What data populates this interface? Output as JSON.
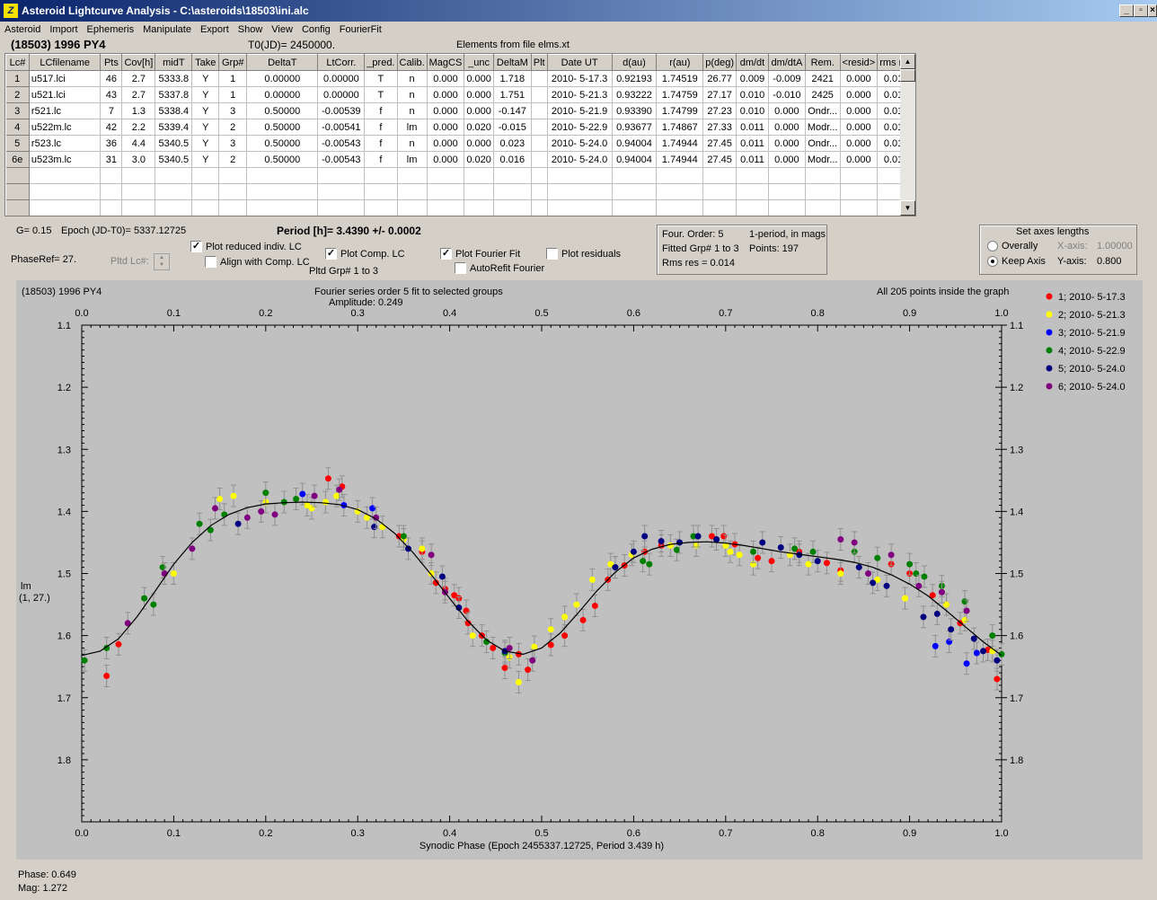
{
  "window": {
    "title": "Asteroid Lightcurve Analysis - C:\\asteroids\\18503\\ini.alc",
    "icon": "app-icon"
  },
  "menu": [
    "Asteroid",
    "Import",
    "Ephemeris",
    "Manipulate",
    "Export",
    "Show",
    "View",
    "Config",
    "FourierFit"
  ],
  "header": {
    "object": "(18503) 1996 PY4",
    "t0": "T0(JD)= 2450000.",
    "elements": "Elements from file elms.xt"
  },
  "table": {
    "columns": [
      "Lc#",
      "LCfilename",
      "Pts",
      "Cov[h]",
      "midT",
      "Take",
      "Grp#",
      "DeltaT",
      "LtCorr.",
      "_pred.",
      "Calib.",
      "MagCS",
      "_unc",
      "DeltaM",
      "Plt",
      "Date UT",
      "d(au)",
      "r(au)",
      "p(deg)",
      "dm/dt",
      "dm/dtA",
      "Rem.",
      "<resid>",
      "rms res"
    ],
    "rows": [
      [
        "1",
        "u517.lci",
        "46",
        "2.7",
        "5333.8",
        "Y",
        "1",
        "0.00000",
        "0.00000",
        "T",
        "n",
        "0.000",
        "0.000",
        "1.718",
        "",
        "2010- 5-17.3",
        "0.92193",
        "1.74519",
        "26.77",
        "0.009",
        "-0.009",
        "2421",
        "0.000",
        "0.015"
      ],
      [
        "2",
        "u521.lci",
        "43",
        "2.7",
        "5337.8",
        "Y",
        "1",
        "0.00000",
        "0.00000",
        "T",
        "n",
        "0.000",
        "0.000",
        "1.751",
        "",
        "2010- 5-21.3",
        "0.93222",
        "1.74759",
        "27.17",
        "0.010",
        "-0.010",
        "2425",
        "0.000",
        "0.013"
      ],
      [
        "3",
        "r521.lc",
        "7",
        "1.3",
        "5338.4",
        "Y",
        "3",
        "0.50000",
        "-0.00539",
        "f",
        "n",
        "0.000",
        "0.000",
        "-0.147",
        "",
        "2010- 5-21.9",
        "0.93390",
        "1.74799",
        "27.23",
        "0.010",
        "0.000",
        "Ondr...",
        "0.000",
        "0.016"
      ],
      [
        "4",
        "u522m.lc",
        "42",
        "2.2",
        "5339.4",
        "Y",
        "2",
        "0.50000",
        "-0.00541",
        "f",
        "lm",
        "0.000",
        "0.020",
        "-0.015",
        "",
        "2010- 5-22.9",
        "0.93677",
        "1.74867",
        "27.33",
        "0.011",
        "0.000",
        "Modr...",
        "0.000",
        "0.013"
      ],
      [
        "5",
        "r523.lc",
        "36",
        "4.4",
        "5340.5",
        "Y",
        "3",
        "0.50000",
        "-0.00543",
        "f",
        "n",
        "0.000",
        "0.000",
        "0.023",
        "",
        "2010- 5-24.0",
        "0.94004",
        "1.74944",
        "27.45",
        "0.011",
        "0.000",
        "Ondr...",
        "0.000",
        "0.013"
      ],
      [
        "6e",
        "u523m.lc",
        "31",
        "3.0",
        "5340.5",
        "Y",
        "2",
        "0.50000",
        "-0.00543",
        "f",
        "lm",
        "0.000",
        "0.020",
        "0.016",
        "",
        "2010- 5-24.0",
        "0.94004",
        "1.74944",
        "27.45",
        "0.011",
        "0.000",
        "Modr...",
        "0.000",
        "0.014"
      ]
    ],
    "empty_rows": 3
  },
  "info": {
    "g": "G= 0.15",
    "epoch": "Epoch (JD-T0)= 5337.12725",
    "period": "Period [h]= 3.4390 +/- 0.0002",
    "phase_ref": "PhaseRef= 27.",
    "pltd_lc": "Pltd Lc#:",
    "plot_reduced": "Plot reduced indiv. LC",
    "align": "Align with Comp. LC",
    "plot_comp": "Plot Comp. LC",
    "pltd_grp": "Pltd Grp#  1   to   3",
    "plot_fourier": "Plot Fourier Fit",
    "autorefit": "AutoRefit Fourier",
    "plot_residuals": "Plot residuals",
    "fourier_box": {
      "order": "Four. Order:  5",
      "mode": "1-period,  in mags",
      "fitted": "Fitted Grp# 1 to 3",
      "points": "Points: 197",
      "rms": "Rms res     = 0.014"
    },
    "axes_box": {
      "title": "Set axes lengths",
      "overally": "Overally",
      "keep_axis": "Keep Axis",
      "x_axis_label": "X-axis:",
      "x_axis_value": "1.00000",
      "y_axis_label": "Y-axis:",
      "y_axis_value": "0.800"
    }
  },
  "plot_header": {
    "object": "(18503) 1996 PY4",
    "fourier_line1": "Fourier series order 5 fit to selected groups",
    "fourier_line2": "Amplitude: 0.249",
    "points_inside": "All 205 points inside the graph",
    "ylabel_line1": "lm",
    "ylabel_line2": "(1, 27.)"
  },
  "status": {
    "phase": "Phase:  0.649",
    "mag": "Mag:    1.272"
  },
  "chart_data": {
    "type": "scatter",
    "title": "",
    "xlabel": "Synodic Phase (Epoch 2455337.12725, Period 3.439 h)",
    "ylabel": "lm",
    "xlim": [
      0.0,
      1.0
    ],
    "ylim": [
      1.1,
      1.9
    ],
    "y_inverted": true,
    "x_ticks": [
      "0.0",
      "0.1",
      "0.2",
      "0.3",
      "0.4",
      "0.5",
      "0.6",
      "0.7",
      "0.8",
      "0.9",
      "1.0"
    ],
    "y_ticks": [
      "1.1",
      "1.2",
      "1.3",
      "1.4",
      "1.5",
      "1.6",
      "1.7",
      "1.8"
    ],
    "legend_position": "right",
    "series": [
      {
        "name": "1; 2010- 5-17.3",
        "color": "#ff0000",
        "points": [
          [
            0.027,
            1.665
          ],
          [
            0.04,
            1.614
          ],
          [
            0.268,
            1.347
          ],
          [
            0.283,
            1.36
          ],
          [
            0.345,
            1.44
          ],
          [
            0.37,
            1.465
          ],
          [
            0.385,
            1.515
          ],
          [
            0.395,
            1.525
          ],
          [
            0.405,
            1.535
          ],
          [
            0.41,
            1.54
          ],
          [
            0.418,
            1.56
          ],
          [
            0.42,
            1.58
          ],
          [
            0.435,
            1.6
          ],
          [
            0.447,
            1.62
          ],
          [
            0.46,
            1.652
          ],
          [
            0.475,
            1.63
          ],
          [
            0.485,
            1.655
          ],
          [
            0.51,
            1.615
          ],
          [
            0.525,
            1.6
          ],
          [
            0.545,
            1.575
          ],
          [
            0.558,
            1.552
          ],
          [
            0.572,
            1.51
          ],
          [
            0.59,
            1.487
          ],
          [
            0.612,
            1.465
          ],
          [
            0.63,
            1.455
          ],
          [
            0.685,
            1.44
          ],
          [
            0.698,
            1.44
          ],
          [
            0.71,
            1.453
          ],
          [
            0.735,
            1.475
          ],
          [
            0.75,
            1.48
          ],
          [
            0.78,
            1.465
          ],
          [
            0.81,
            1.483
          ],
          [
            0.825,
            1.495
          ],
          [
            0.88,
            1.485
          ],
          [
            0.9,
            1.5
          ],
          [
            0.925,
            1.535
          ],
          [
            0.94,
            1.55
          ],
          [
            0.955,
            1.58
          ],
          [
            0.985,
            1.623
          ],
          [
            0.995,
            1.67
          ]
        ]
      },
      {
        "name": "2; 2010- 5-21.3",
        "color": "#ffff00",
        "points": [
          [
            0.1,
            1.5
          ],
          [
            0.15,
            1.38
          ],
          [
            0.165,
            1.375
          ],
          [
            0.2,
            1.385
          ],
          [
            0.245,
            1.39
          ],
          [
            0.25,
            1.395
          ],
          [
            0.265,
            1.385
          ],
          [
            0.277,
            1.375
          ],
          [
            0.3,
            1.4
          ],
          [
            0.31,
            1.41
          ],
          [
            0.327,
            1.425
          ],
          [
            0.35,
            1.445
          ],
          [
            0.37,
            1.46
          ],
          [
            0.38,
            1.5
          ],
          [
            0.425,
            1.6
          ],
          [
            0.465,
            1.635
          ],
          [
            0.475,
            1.675
          ],
          [
            0.492,
            1.618
          ],
          [
            0.51,
            1.59
          ],
          [
            0.525,
            1.57
          ],
          [
            0.538,
            1.55
          ],
          [
            0.555,
            1.51
          ],
          [
            0.575,
            1.485
          ],
          [
            0.598,
            1.47
          ],
          [
            0.64,
            1.455
          ],
          [
            0.668,
            1.455
          ],
          [
            0.7,
            1.455
          ],
          [
            0.705,
            1.465
          ],
          [
            0.715,
            1.47
          ],
          [
            0.73,
            1.485
          ],
          [
            0.77,
            1.47
          ],
          [
            0.79,
            1.485
          ],
          [
            0.825,
            1.5
          ],
          [
            0.865,
            1.51
          ],
          [
            0.895,
            1.54
          ],
          [
            0.94,
            1.55
          ],
          [
            0.96,
            1.575
          ],
          [
            0.99,
            1.625
          ]
        ]
      },
      {
        "name": "3; 2010- 5-21.9",
        "color": "#0000ff",
        "points": [
          [
            0.24,
            1.372
          ],
          [
            0.285,
            1.39
          ],
          [
            0.316,
            1.395
          ],
          [
            0.928,
            1.617
          ],
          [
            0.943,
            1.61
          ],
          [
            0.962,
            1.645
          ],
          [
            0.973,
            1.628
          ]
        ]
      },
      {
        "name": "4; 2010- 5-22.9",
        "color": "#008000",
        "points": [
          [
            0.003,
            1.64
          ],
          [
            0.027,
            1.62
          ],
          [
            0.068,
            1.54
          ],
          [
            0.078,
            1.55
          ],
          [
            0.088,
            1.49
          ],
          [
            0.128,
            1.42
          ],
          [
            0.14,
            1.43
          ],
          [
            0.155,
            1.405
          ],
          [
            0.2,
            1.37
          ],
          [
            0.22,
            1.385
          ],
          [
            0.233,
            1.38
          ],
          [
            0.35,
            1.44
          ],
          [
            0.44,
            1.61
          ],
          [
            0.46,
            1.628
          ],
          [
            0.58,
            1.49
          ],
          [
            0.61,
            1.48
          ],
          [
            0.617,
            1.485
          ],
          [
            0.647,
            1.462
          ],
          [
            0.665,
            1.44
          ],
          [
            0.69,
            1.445
          ],
          [
            0.73,
            1.465
          ],
          [
            0.775,
            1.46
          ],
          [
            0.795,
            1.465
          ],
          [
            0.84,
            1.465
          ],
          [
            0.865,
            1.475
          ],
          [
            0.9,
            1.485
          ],
          [
            0.907,
            1.5
          ],
          [
            0.916,
            1.505
          ],
          [
            0.935,
            1.52
          ],
          [
            0.96,
            1.545
          ],
          [
            0.99,
            1.6
          ],
          [
            1.0,
            1.63
          ]
        ]
      },
      {
        "name": "5; 2010- 5-24.0",
        "color": "#000080",
        "points": [
          [
            0.17,
            1.42
          ],
          [
            0.318,
            1.425
          ],
          [
            0.355,
            1.46
          ],
          [
            0.392,
            1.505
          ],
          [
            0.41,
            1.555
          ],
          [
            0.46,
            1.625
          ],
          [
            0.58,
            1.49
          ],
          [
            0.6,
            1.465
          ],
          [
            0.612,
            1.44
          ],
          [
            0.63,
            1.448
          ],
          [
            0.65,
            1.45
          ],
          [
            0.67,
            1.44
          ],
          [
            0.69,
            1.445
          ],
          [
            0.74,
            1.45
          ],
          [
            0.76,
            1.458
          ],
          [
            0.78,
            1.47
          ],
          [
            0.8,
            1.48
          ],
          [
            0.845,
            1.49
          ],
          [
            0.86,
            1.515
          ],
          [
            0.875,
            1.52
          ],
          [
            0.915,
            1.57
          ],
          [
            0.93,
            1.565
          ],
          [
            0.945,
            1.59
          ],
          [
            0.97,
            1.605
          ],
          [
            0.98,
            1.625
          ],
          [
            0.995,
            1.64
          ]
        ]
      },
      {
        "name": "6; 2010- 5-24.0",
        "color": "#800080",
        "points": [
          [
            0.05,
            1.58
          ],
          [
            0.09,
            1.5
          ],
          [
            0.12,
            1.46
          ],
          [
            0.145,
            1.395
          ],
          [
            0.18,
            1.41
          ],
          [
            0.195,
            1.4
          ],
          [
            0.21,
            1.405
          ],
          [
            0.253,
            1.375
          ],
          [
            0.28,
            1.365
          ],
          [
            0.32,
            1.41
          ],
          [
            0.38,
            1.47
          ],
          [
            0.395,
            1.53
          ],
          [
            0.465,
            1.62
          ],
          [
            0.49,
            1.64
          ],
          [
            0.825,
            1.445
          ],
          [
            0.84,
            1.45
          ],
          [
            0.855,
            1.5
          ],
          [
            0.88,
            1.47
          ],
          [
            0.91,
            1.52
          ],
          [
            0.935,
            1.53
          ],
          [
            0.962,
            1.56
          ]
        ]
      }
    ],
    "fit_curve": {
      "name": "Fourier fit",
      "points": [
        [
          0.0,
          1.632
        ],
        [
          0.02,
          1.625
        ],
        [
          0.04,
          1.605
        ],
        [
          0.06,
          1.57
        ],
        [
          0.08,
          1.528
        ],
        [
          0.1,
          1.485
        ],
        [
          0.12,
          1.45
        ],
        [
          0.14,
          1.423
        ],
        [
          0.16,
          1.405
        ],
        [
          0.18,
          1.394
        ],
        [
          0.2,
          1.388
        ],
        [
          0.22,
          1.386
        ],
        [
          0.24,
          1.385
        ],
        [
          0.26,
          1.386
        ],
        [
          0.28,
          1.389
        ],
        [
          0.3,
          1.397
        ],
        [
          0.32,
          1.412
        ],
        [
          0.34,
          1.435
        ],
        [
          0.36,
          1.466
        ],
        [
          0.38,
          1.502
        ],
        [
          0.4,
          1.54
        ],
        [
          0.42,
          1.577
        ],
        [
          0.44,
          1.607
        ],
        [
          0.46,
          1.625
        ],
        [
          0.48,
          1.63
        ],
        [
          0.5,
          1.62
        ],
        [
          0.52,
          1.596
        ],
        [
          0.54,
          1.563
        ],
        [
          0.56,
          1.528
        ],
        [
          0.58,
          1.498
        ],
        [
          0.6,
          1.475
        ],
        [
          0.62,
          1.461
        ],
        [
          0.64,
          1.453
        ],
        [
          0.66,
          1.45
        ],
        [
          0.68,
          1.449
        ],
        [
          0.7,
          1.451
        ],
        [
          0.72,
          1.455
        ],
        [
          0.74,
          1.46
        ],
        [
          0.76,
          1.465
        ],
        [
          0.78,
          1.469
        ],
        [
          0.8,
          1.473
        ],
        [
          0.82,
          1.477
        ],
        [
          0.84,
          1.482
        ],
        [
          0.86,
          1.49
        ],
        [
          0.88,
          1.502
        ],
        [
          0.9,
          1.517
        ],
        [
          0.92,
          1.536
        ],
        [
          0.94,
          1.56
        ],
        [
          0.96,
          1.585
        ],
        [
          0.98,
          1.61
        ],
        [
          1.0,
          1.632
        ]
      ]
    }
  }
}
